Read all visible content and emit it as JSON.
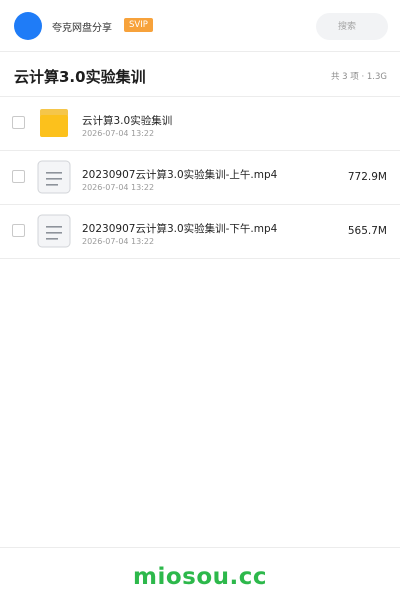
{
  "header": {
    "user_name": "夸克网盘分享",
    "badge": "SVIP",
    "search_placeholder": "搜索",
    "avatar_color": "#1f7cf7"
  },
  "folder": {
    "title": "云计算3.0实验集训",
    "summary": "共 3 项 · 1.3G"
  },
  "files": [
    {
      "name": "云计算3.0实验集训",
      "date": "2026-07-04 13:22",
      "size": "",
      "icon": "folder-icon"
    },
    {
      "name": "20230907云计算3.0实验集训-上午.mp4",
      "date": "2026-07-04 13:22",
      "size": "772.9M",
      "icon": "document-icon"
    },
    {
      "name": "20230907云计算3.0实验集训-下午.mp4",
      "date": "2026-07-04 13:22",
      "size": "565.7M",
      "icon": "document-icon"
    }
  ],
  "footer": {
    "watermark": "miosou.cc"
  }
}
